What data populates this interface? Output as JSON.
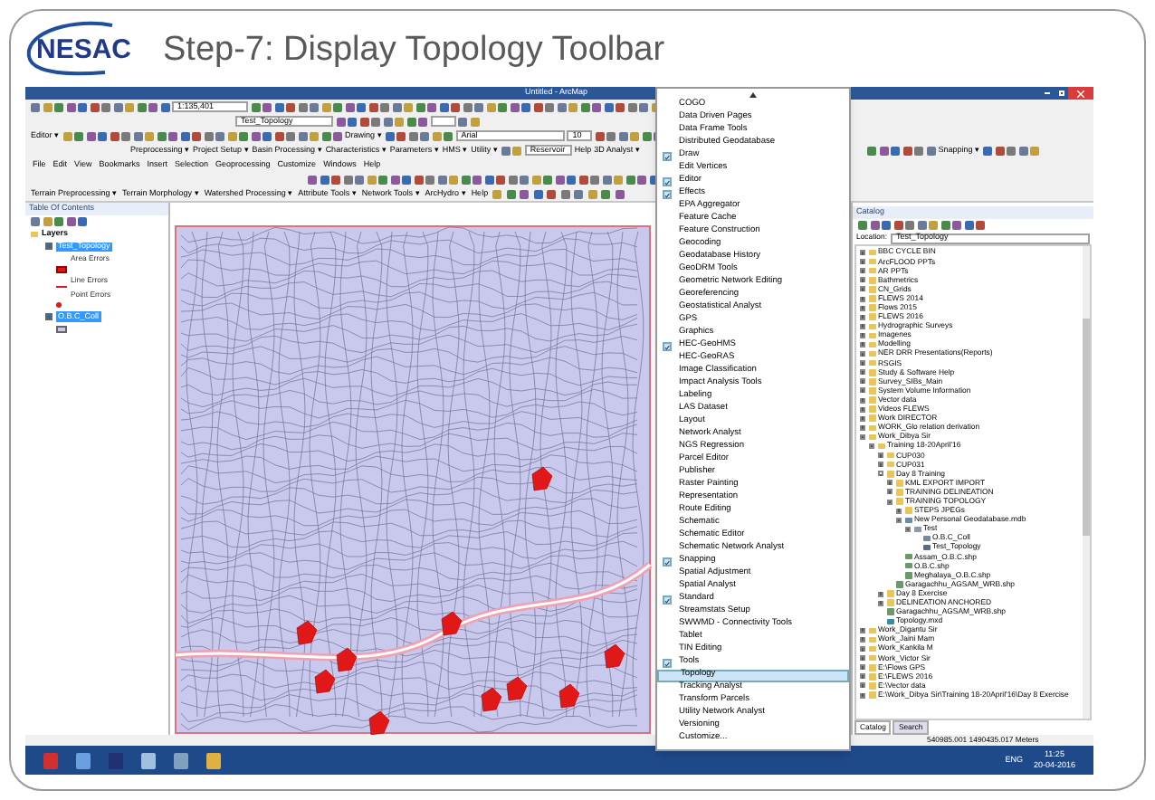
{
  "slide": {
    "logo": "NESAC",
    "title": "Step-7: Display Topology Toolbar"
  },
  "window": {
    "title": "Untitled - ArcMap"
  },
  "toolbars": {
    "scale": "1:135,401",
    "layer": "Test_Topology",
    "editor": "Editor ▾",
    "drawing": "Drawing ▾",
    "font": "Arial",
    "font_size": "10",
    "hec_menus": [
      "Preprocessing ▾",
      "Project Setup ▾",
      "Basin Processing ▾",
      "Characteristics ▾",
      "Parameters ▾",
      "HMS ▾",
      "Utility ▾"
    ],
    "reservoir": "Reservoir",
    "help": "Help",
    "analyst": "3D Analyst ▾",
    "snapping": "Snapping ▾",
    "hydro_menus": [
      "Terrain Preprocessing ▾",
      "Terrain Morphology ▾",
      "Watershed Processing ▾",
      "Attribute Tools ▾",
      "Network Tools ▾",
      "ArcHydro ▾",
      "Help"
    ]
  },
  "menu_bar": [
    "File",
    "Edit",
    "View",
    "Bookmarks",
    "Insert",
    "Selection",
    "Geoprocessing",
    "Customize",
    "Windows",
    "Help"
  ],
  "toc": {
    "title": "Table Of Contents",
    "root": "Layers",
    "layers": [
      {
        "name": "Test_Topology",
        "selected": true,
        "checked": true,
        "legend": [
          {
            "kind": "area",
            "label": "Area Errors"
          },
          {
            "kind": "line",
            "label": "Line Errors"
          },
          {
            "kind": "point",
            "label": "Point Errors"
          }
        ]
      },
      {
        "name": "O.B.C_Coll",
        "selected": true,
        "checked": true,
        "legend": [
          {
            "kind": "fill"
          }
        ]
      }
    ]
  },
  "toolbar_menu": [
    {
      "label": "COGO",
      "checked": false,
      "selected": false
    },
    {
      "label": "Data Driven Pages",
      "checked": false,
      "selected": false
    },
    {
      "label": "Data Frame Tools",
      "checked": false,
      "selected": false
    },
    {
      "label": "Distributed Geodatabase",
      "checked": false,
      "selected": false
    },
    {
      "label": "Draw",
      "checked": true,
      "selected": false
    },
    {
      "label": "Edit Vertices",
      "checked": false,
      "selected": false
    },
    {
      "label": "Editor",
      "checked": true,
      "selected": false
    },
    {
      "label": "Effects",
      "checked": true,
      "selected": false
    },
    {
      "label": "EPA Aggregator",
      "checked": false,
      "selected": false
    },
    {
      "label": "Feature Cache",
      "checked": false,
      "selected": false
    },
    {
      "label": "Feature Construction",
      "checked": false,
      "selected": false
    },
    {
      "label": "Geocoding",
      "checked": false,
      "selected": false
    },
    {
      "label": "Geodatabase History",
      "checked": false,
      "selected": false
    },
    {
      "label": "GeoDRM Tools",
      "checked": false,
      "selected": false
    },
    {
      "label": "Geometric Network Editing",
      "checked": false,
      "selected": false
    },
    {
      "label": "Georeferencing",
      "checked": false,
      "selected": false
    },
    {
      "label": "Geostatistical Analyst",
      "checked": false,
      "selected": false
    },
    {
      "label": "GPS",
      "checked": false,
      "selected": false
    },
    {
      "label": "Graphics",
      "checked": false,
      "selected": false
    },
    {
      "label": "HEC-GeoHMS",
      "checked": true,
      "selected": false
    },
    {
      "label": "HEC-GeoRAS",
      "checked": false,
      "selected": false
    },
    {
      "label": "Image Classification",
      "checked": false,
      "selected": false
    },
    {
      "label": "Impact Analysis Tools",
      "checked": false,
      "selected": false
    },
    {
      "label": "Labeling",
      "checked": false,
      "selected": false
    },
    {
      "label": "LAS Dataset",
      "checked": false,
      "selected": false
    },
    {
      "label": "Layout",
      "checked": false,
      "selected": false
    },
    {
      "label": "Network Analyst",
      "checked": false,
      "selected": false
    },
    {
      "label": "NGS Regression",
      "checked": false,
      "selected": false
    },
    {
      "label": "Parcel Editor",
      "checked": false,
      "selected": false
    },
    {
      "label": "Publisher",
      "checked": false,
      "selected": false
    },
    {
      "label": "Raster Painting",
      "checked": false,
      "selected": false
    },
    {
      "label": "Representation",
      "checked": false,
      "selected": false
    },
    {
      "label": "Route Editing",
      "checked": false,
      "selected": false
    },
    {
      "label": "Schematic",
      "checked": false,
      "selected": false
    },
    {
      "label": "Schematic Editor",
      "checked": false,
      "selected": false
    },
    {
      "label": "Schematic Network Analyst",
      "checked": false,
      "selected": false
    },
    {
      "label": "Snapping",
      "checked": true,
      "selected": false
    },
    {
      "label": "Spatial Adjustment",
      "checked": false,
      "selected": false
    },
    {
      "label": "Spatial Analyst",
      "checked": false,
      "selected": false
    },
    {
      "label": "Standard",
      "checked": true,
      "selected": false
    },
    {
      "label": "Streamstats Setup",
      "checked": false,
      "selected": false
    },
    {
      "label": "SWWMD - Connectivity Tools",
      "checked": false,
      "selected": false
    },
    {
      "label": "Tablet",
      "checked": false,
      "selected": false
    },
    {
      "label": "TIN Editing",
      "checked": false,
      "selected": false
    },
    {
      "label": "Tools",
      "checked": true,
      "selected": false
    },
    {
      "label": "Topology",
      "checked": false,
      "selected": true
    },
    {
      "label": "Tracking Analyst",
      "checked": false,
      "selected": false
    },
    {
      "label": "Transform Parcels",
      "checked": false,
      "selected": false
    },
    {
      "label": "Utility Network Analyst",
      "checked": false,
      "selected": false
    },
    {
      "label": "Versioning",
      "checked": false,
      "selected": false
    },
    {
      "label": "Customize...",
      "checked": false,
      "selected": false
    }
  ],
  "catalog": {
    "title": "Catalog",
    "location_label": "Location:",
    "location": "Test_Topology",
    "tree": [
      {
        "label": "BBC CYCLE BIN",
        "kind": "folder",
        "expanded": false
      },
      {
        "label": "ArcFLOOD PPTs",
        "kind": "folder",
        "expanded": false
      },
      {
        "label": "AR PPTs",
        "kind": "folder",
        "expanded": false
      },
      {
        "label": "Bathmetrics",
        "kind": "folder",
        "expanded": false
      },
      {
        "label": "CN_Grids",
        "kind": "folder",
        "expanded": false
      },
      {
        "label": "FLEWS 2014",
        "kind": "folder",
        "expanded": false
      },
      {
        "label": "Flows 2015",
        "kind": "folder",
        "expanded": false
      },
      {
        "label": "FLEWS 2016",
        "kind": "folder",
        "expanded": false
      },
      {
        "label": "Hydrographic Surveys",
        "kind": "folder",
        "expanded": false
      },
      {
        "label": "Imagenes",
        "kind": "folder",
        "expanded": false
      },
      {
        "label": "Modelling",
        "kind": "folder",
        "expanded": false
      },
      {
        "label": "NER DRR Presentations(Reports)",
        "kind": "folder",
        "expanded": false
      },
      {
        "label": "RSGIS",
        "kind": "folder",
        "expanded": false
      },
      {
        "label": "Study & Software Help",
        "kind": "folder",
        "expanded": false
      },
      {
        "label": "Survey_SIBs_Main",
        "kind": "folder",
        "expanded": false
      },
      {
        "label": "System Volume Information",
        "kind": "folder",
        "expanded": false
      },
      {
        "label": "Vector data",
        "kind": "folder",
        "expanded": false
      },
      {
        "label": "Videos FLEWS",
        "kind": "folder",
        "expanded": false
      },
      {
        "label": "Work DIRECTOR",
        "kind": "folder",
        "expanded": false
      },
      {
        "label": "WORK_Glo relation derivation",
        "kind": "folder",
        "expanded": false
      },
      {
        "label": "Work_Dibya Sir",
        "kind": "folder",
        "expanded": true,
        "children": [
          {
            "label": "Training 18-20April'16",
            "kind": "folder",
            "expanded": true,
            "children": [
              {
                "label": "CUP030",
                "kind": "folder",
                "expanded": false
              },
              {
                "label": "CUP031",
                "kind": "folder",
                "expanded": false
              },
              {
                "label": "Day 8 Training",
                "kind": "folder",
                "expanded": true,
                "children": [
                  {
                    "label": "KML EXPORT IMPORT",
                    "kind": "folder",
                    "expanded": false
                  },
                  {
                    "label": "TRAINING DELINEATION",
                    "kind": "folder",
                    "expanded": false
                  },
                  {
                    "label": "TRAINING TOPOLOGY",
                    "kind": "folder",
                    "expanded": true,
                    "children": [
                      {
                        "label": "STEPS JPEGs",
                        "kind": "folder",
                        "expanded": false
                      },
                      {
                        "label": "New Personal Geodatabase.mdb",
                        "kind": "geodatabase",
                        "expanded": true,
                        "children": [
                          {
                            "label": "Test",
                            "kind": "dataset",
                            "expanded": true,
                            "children": [
                              {
                                "label": "O.B.C_Coll",
                                "kind": "feature"
                              },
                              {
                                "label": "Test_Topology",
                                "kind": "topology"
                              }
                            ]
                          }
                        ]
                      },
                      {
                        "label": "Assam_O.B.C.shp",
                        "kind": "shapefile"
                      },
                      {
                        "label": "O.B.C.shp",
                        "kind": "shapefile"
                      },
                      {
                        "label": "Meghalaya_O.B.C.shp",
                        "kind": "shapefile"
                      }
                    ]
                  },
                  {
                    "label": "Garagachhu_AGSAM_WRB.shp",
                    "kind": "shapefile"
                  }
                ]
              },
              {
                "label": "Day 8 Exercise",
                "kind": "folder",
                "expanded": false
              },
              {
                "label": "DELINEATION ANCHORED",
                "kind": "folder",
                "expanded": false
              },
              {
                "label": "Garagachhu_AGSAM_WRB.shp",
                "kind": "shapefile"
              },
              {
                "label": "Topology.mxd",
                "kind": "mxd"
              }
            ]
          }
        ]
      },
      {
        "label": "Work_Digantu Sir",
        "kind": "folder",
        "expanded": false
      },
      {
        "label": "Work_Jaini Mam",
        "kind": "folder",
        "expanded": false
      },
      {
        "label": "Work_Kankila M",
        "kind": "folder",
        "expanded": false
      },
      {
        "label": "Work_Victor Sir",
        "kind": "folder",
        "expanded": false
      },
      {
        "label": "E:\\Flows GPS",
        "kind": "folder",
        "expanded": false
      },
      {
        "label": "E:\\FLEWS 2016",
        "kind": "folder",
        "expanded": false
      },
      {
        "label": "E:\\Vector data",
        "kind": "folder",
        "expanded": false
      },
      {
        "label": "E:\\Work_Dibya Sir\\Training 18-20April'16\\Day 8 Exercise",
        "kind": "folder",
        "expanded": false
      }
    ],
    "tabs": [
      {
        "label": "Catalog",
        "selected": true
      },
      {
        "label": "Search",
        "selected": false
      }
    ]
  },
  "status_bar": {
    "coordinates": "540985.001 1490435.017 Meters"
  },
  "taskbar": {
    "language": "ENG",
    "time": "11:25",
    "date": "20-04-2016"
  }
}
